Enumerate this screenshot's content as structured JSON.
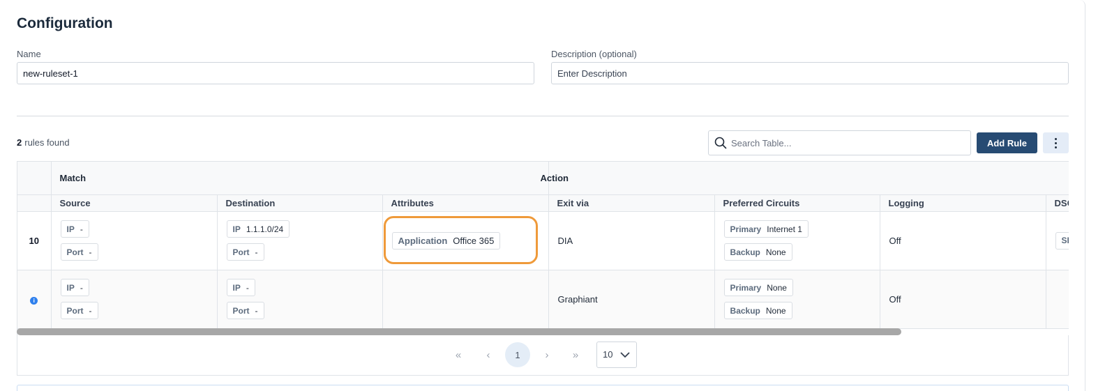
{
  "page_title": "Configuration",
  "form": {
    "name_label": "Name",
    "name_value": "new-ruleset-1",
    "description_label": "Description (optional)",
    "description_placeholder": "Enter Description"
  },
  "toolbar": {
    "rules_count": "2",
    "rules_found_text": "rules found",
    "search_placeholder": "Search Table...",
    "add_rule_label": "Add Rule",
    "search_icon": "search-icon",
    "more_icon": "kebab-menu-icon"
  },
  "table": {
    "group_headers": {
      "match": "Match",
      "action": "Action"
    },
    "columns": [
      "Source",
      "Destination",
      "Attributes",
      "Exit via",
      "Preferred Circuits",
      "Logging",
      "DSC"
    ],
    "rows": [
      {
        "index": "10",
        "source": [
          {
            "k": "IP",
            "v": "-"
          },
          {
            "k": "Port",
            "v": "-"
          }
        ],
        "destination": [
          {
            "k": "IP",
            "v": "1.1.1.0/24"
          },
          {
            "k": "Port",
            "v": "-"
          }
        ],
        "attributes": [
          {
            "k": "Application",
            "v": "Office 365"
          }
        ],
        "exit_via": "DIA",
        "circuits": [
          {
            "k": "Primary",
            "v": "Internet 1"
          },
          {
            "k": "Backup",
            "v": "None"
          }
        ],
        "logging": "Off",
        "dscp": "SL"
      },
      {
        "index_icon": "info-icon",
        "index_glyph": "i",
        "source": [
          {
            "k": "IP",
            "v": "-"
          },
          {
            "k": "Port",
            "v": "-"
          }
        ],
        "destination": [
          {
            "k": "IP",
            "v": "-"
          },
          {
            "k": "Port",
            "v": "-"
          }
        ],
        "attributes": [],
        "exit_via": "Graphiant",
        "circuits": [
          {
            "k": "Primary",
            "v": "None"
          },
          {
            "k": "Backup",
            "v": "None"
          }
        ],
        "logging": "Off",
        "dscp": ""
      }
    ]
  },
  "pagination": {
    "first": "«",
    "prev": "‹",
    "current_page": "1",
    "next": "›",
    "last": "»",
    "per_page": "10"
  },
  "colors": {
    "primary_button": "#274b73",
    "highlight": "#ef9a3a",
    "info": "#2f80ed"
  }
}
